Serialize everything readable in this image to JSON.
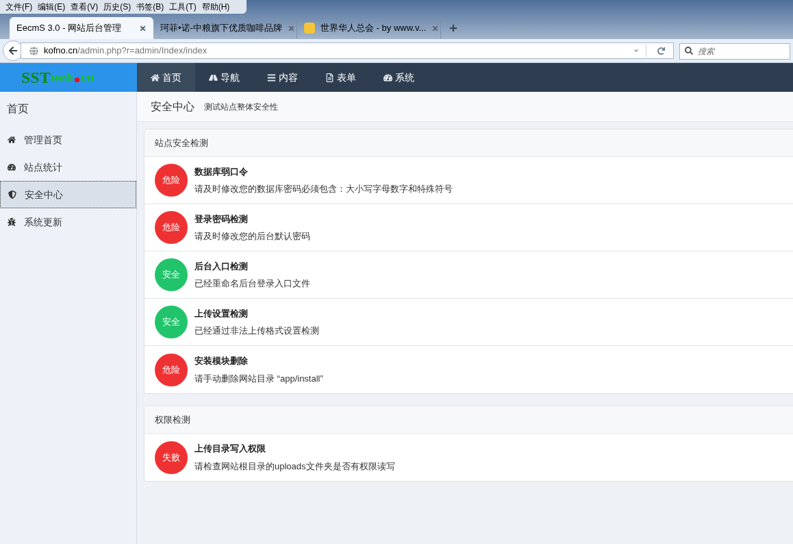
{
  "menu_bar": [
    "文件(F)",
    "编辑(E)",
    "查看(V)",
    "历史(S)",
    "书签(B)",
    "工具(T)",
    "帮助(H)"
  ],
  "tabs": [
    {
      "title": "EecmS 3.0 - 网站后台管理",
      "selected": true,
      "favicon": false
    },
    {
      "title": "珂菲•诺-中粮旗下优质咖啡品牌",
      "selected": false,
      "favicon": false
    },
    {
      "title": "世界华人总会 - by www.v...",
      "selected": false,
      "favicon": true
    }
  ],
  "address": {
    "domain": "kofno.cn",
    "path": "/admin.php?r=admin/Index/index"
  },
  "search": {
    "placeholder": "搜索"
  },
  "logo": {
    "part1": "SST",
    "part2": "web",
    "part3": "cn"
  },
  "nav": [
    {
      "label": "首页",
      "selected": true
    },
    {
      "label": "导航",
      "selected": false
    },
    {
      "label": "内容",
      "selected": false
    },
    {
      "label": "表单",
      "selected": false
    },
    {
      "label": "系统",
      "selected": false
    }
  ],
  "sidebar": {
    "title": "首页",
    "items": [
      {
        "label": "管理首页",
        "selected": false
      },
      {
        "label": "站点统计",
        "selected": false
      },
      {
        "label": "安全中心",
        "selected": true
      },
      {
        "label": "系统更新",
        "selected": false
      }
    ]
  },
  "page": {
    "title": "安全中心",
    "subtitle": "测试站点整体安全性"
  },
  "panels": [
    {
      "title": "站点安全检测",
      "items": [
        {
          "badge": "危险",
          "color": "#ee3233",
          "title": "数据库弱口令",
          "desc": "请及时修改您的数据库密码必须包含：大小写字母数字和特殊符号"
        },
        {
          "badge": "危险",
          "color": "#ee3233",
          "title": "登录密码检测",
          "desc": "请及时修改您的后台默认密码"
        },
        {
          "badge": "安全",
          "color": "#22c46b",
          "title": "后台入口检测",
          "desc": "已经重命名后台登录入口文件"
        },
        {
          "badge": "安全",
          "color": "#22c46b",
          "title": "上传设置检测",
          "desc": "已经通过非法上传格式设置检测"
        },
        {
          "badge": "危险",
          "color": "#ee3233",
          "title": "安装模块删除",
          "desc": "请手动删除网站目录 “app/install”"
        }
      ]
    },
    {
      "title": "权限检测",
      "items": [
        {
          "badge": "失败",
          "color": "#ee3233",
          "title": "上传目录写入权限",
          "desc": "请检查网站根目录的uploads文件夹是否有权限读写"
        }
      ]
    }
  ]
}
